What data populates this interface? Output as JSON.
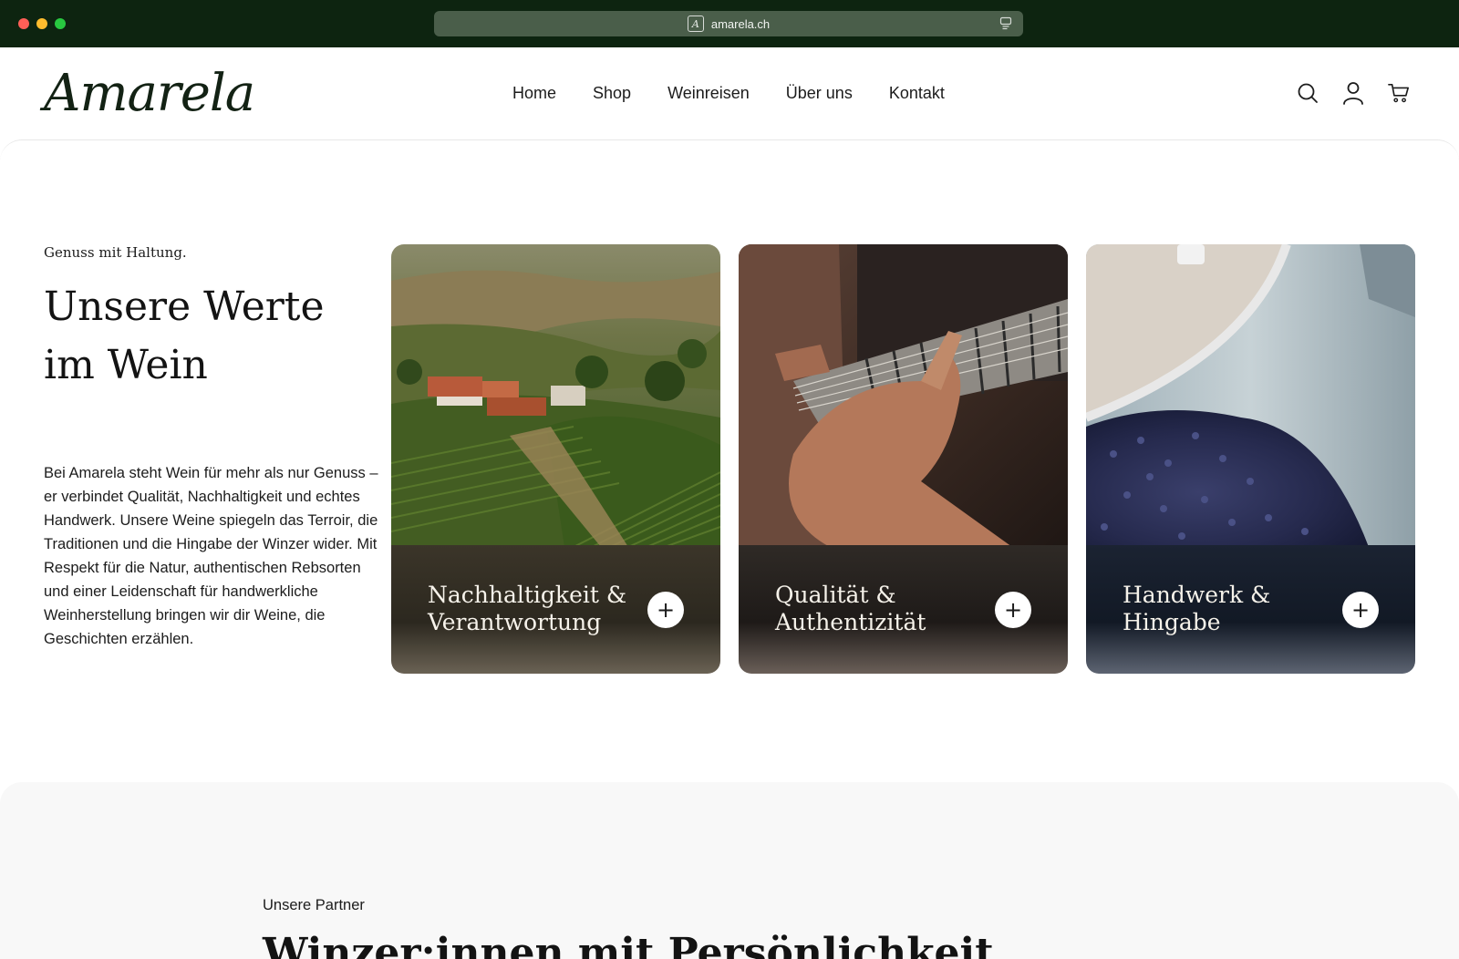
{
  "browser": {
    "url": "amarela.ch"
  },
  "header": {
    "logo_text": "Amarela",
    "nav": [
      {
        "label": "Home"
      },
      {
        "label": "Shop"
      },
      {
        "label": "Weinreisen"
      },
      {
        "label": "Über uns"
      },
      {
        "label": "Kontakt"
      }
    ],
    "icons": [
      "search-icon",
      "account-icon",
      "cart-icon"
    ]
  },
  "values_section": {
    "eyebrow": "Genuss mit Haltung.",
    "title": "Unsere Werte im Wein",
    "description": "Bei Amarela steht Wein für mehr als nur Genuss – er verbindet Qualität, Nachhaltigkeit und echtes Handwerk. Unsere Weine spiegeln das Terroir, die Traditionen und die Hingabe der Winzer wider. Mit Respekt für die Natur, authentischen Rebsorten und einer Leidenschaft für handwerkliche Weinherstellung bringen wir dir Weine, die Geschichten erzählen.",
    "cards": [
      {
        "title": "Nachhaltigkeit & Verantwortung",
        "plus": "+"
      },
      {
        "title": "Qualität & Authentizität",
        "plus": "+"
      },
      {
        "title": "Handwerk & Hingabe",
        "plus": "+"
      }
    ]
  },
  "partner_section": {
    "eyebrow": "Unsere Partner",
    "title": "Winzer:innen mit Persönlichkeit"
  },
  "colors": {
    "chrome_bg": "#0d2410",
    "brand_dark": "#132214",
    "section_bg": "#f8f8f8"
  }
}
